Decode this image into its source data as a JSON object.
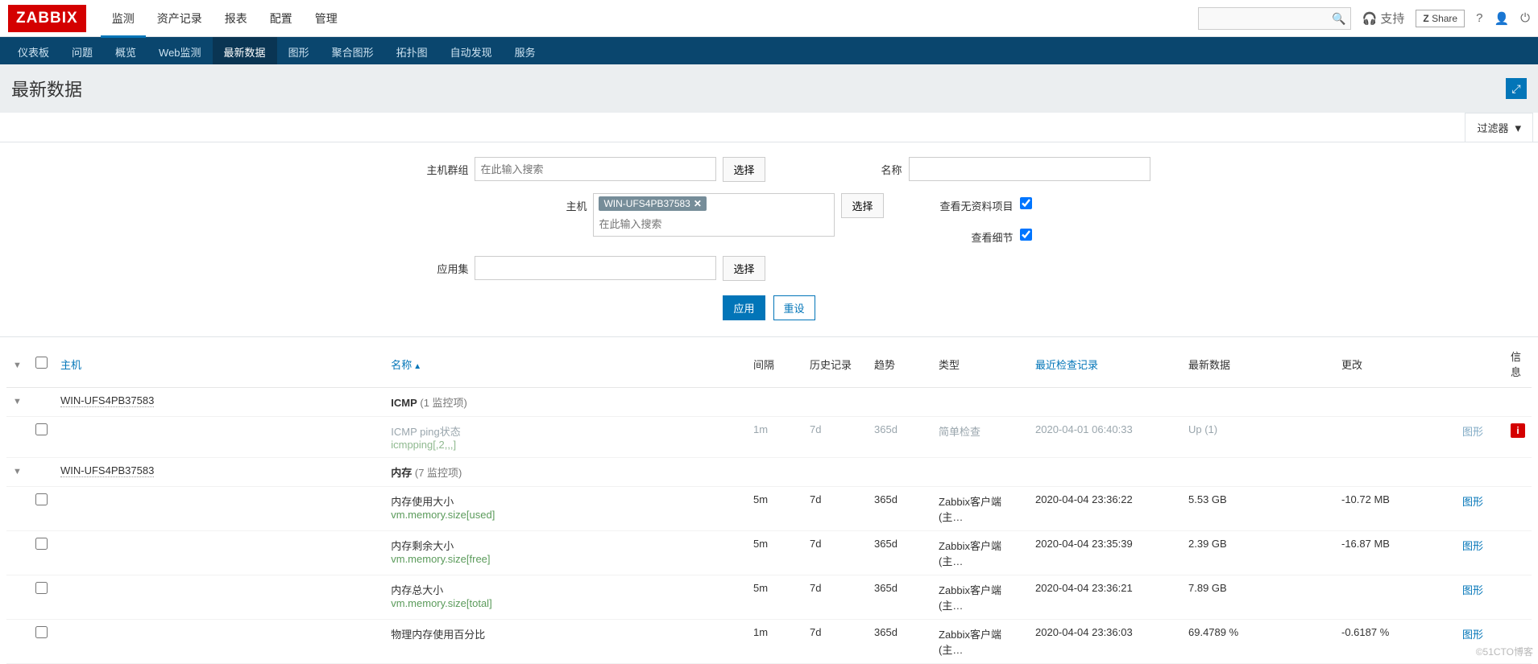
{
  "brand": "ZABBIX",
  "mainnav": [
    "监测",
    "资产记录",
    "报表",
    "配置",
    "管理"
  ],
  "mainnav_active": 0,
  "topright": {
    "support": "支持",
    "share": "Share"
  },
  "subnav": [
    "仪表板",
    "问题",
    "概览",
    "Web监测",
    "最新数据",
    "图形",
    "聚合图形",
    "拓扑图",
    "自动发现",
    "服务"
  ],
  "subnav_active": 4,
  "page_title": "最新数据",
  "filter_tab": "过滤器",
  "filter": {
    "labels": {
      "hostgroup": "主机群组",
      "host": "主机",
      "appset": "应用集",
      "name": "名称",
      "show_no_data": "查看无资料项目",
      "show_details": "查看细节"
    },
    "placeholder": "在此输入搜索",
    "host_chip": "WIN-UFS4PB37583",
    "select_btn": "选择",
    "apply": "应用",
    "reset": "重设",
    "show_no_data_checked": true,
    "show_details_checked": true
  },
  "columns": {
    "host": "主机",
    "name": "名称",
    "interval": "间隔",
    "history": "历史记录",
    "trends": "趋势",
    "type": "类型",
    "lastcheck": "最近检查记录",
    "lastvalue": "最新数据",
    "change": "更改",
    "info": "信息"
  },
  "sections": [
    {
      "host": "WIN-UFS4PB37583",
      "app": "ICMP",
      "count_label": "(1 监控项)",
      "faded": true,
      "items": [
        {
          "name": "ICMP ping状态",
          "key": "icmpping[,2,,,]",
          "interval": "1m",
          "history": "7d",
          "trends": "365d",
          "type": "简单检查",
          "lastcheck": "2020-04-01 06:40:33",
          "lastvalue": "Up (1)",
          "change": "",
          "action": "图形",
          "info": true
        }
      ]
    },
    {
      "host": "WIN-UFS4PB37583",
      "app": "内存",
      "count_label": "(7 监控项)",
      "faded": false,
      "items": [
        {
          "name": "内存使用大小",
          "key": "vm.memory.size[used]",
          "interval": "5m",
          "history": "7d",
          "trends": "365d",
          "type": "Zabbix客户端(主…",
          "lastcheck": "2020-04-04 23:36:22",
          "lastvalue": "5.53 GB",
          "change": "-10.72 MB",
          "action": "图形",
          "info": false
        },
        {
          "name": "内存剩余大小",
          "key": "vm.memory.size[free]",
          "interval": "5m",
          "history": "7d",
          "trends": "365d",
          "type": "Zabbix客户端(主…",
          "lastcheck": "2020-04-04 23:35:39",
          "lastvalue": "2.39 GB",
          "change": "-16.87 MB",
          "action": "图形",
          "info": false
        },
        {
          "name": "内存总大小",
          "key": "vm.memory.size[total]",
          "interval": "5m",
          "history": "7d",
          "trends": "365d",
          "type": "Zabbix客户端(主…",
          "lastcheck": "2020-04-04 23:36:21",
          "lastvalue": "7.89 GB",
          "change": "",
          "action": "图形",
          "info": false
        },
        {
          "name": "物理内存使用百分比",
          "key": "",
          "interval": "1m",
          "history": "7d",
          "trends": "365d",
          "type": "Zabbix客户端(主…",
          "lastcheck": "2020-04-04 23:36:03",
          "lastvalue": "69.4789 %",
          "change": "-0.6187 %",
          "action": "图形",
          "info": false
        }
      ]
    }
  ],
  "watermark": "©51CTO博客"
}
